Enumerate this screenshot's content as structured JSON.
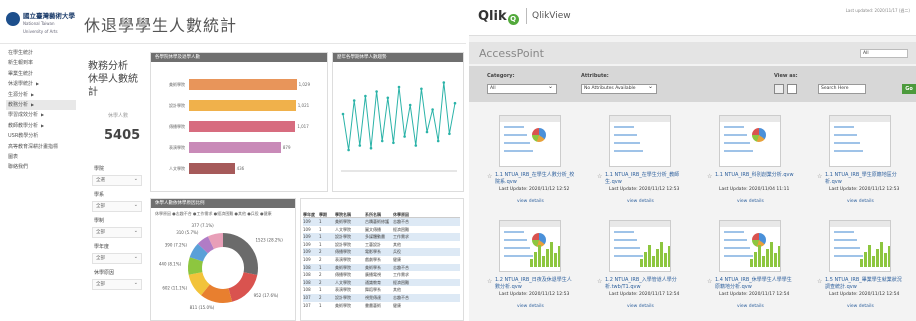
{
  "left": {
    "logo_text": "國立臺灣藝術大學",
    "logo_sub": "National Taiwan University of Arts",
    "page_title": "休退學學生人數統計",
    "nav": [
      {
        "label": "在學生統計",
        "arrow": false
      },
      {
        "label": "新生報到率",
        "arrow": false
      },
      {
        "label": "畢業生統計",
        "arrow": false
      },
      {
        "label": "休退學統計",
        "arrow": true
      },
      {
        "label": "生源分析",
        "arrow": true
      },
      {
        "label": "教務分析",
        "arrow": true,
        "active": true
      },
      {
        "label": "學習成效分析",
        "arrow": true
      },
      {
        "label": "教師教學分析",
        "arrow": true
      },
      {
        "label": "USR教學分析",
        "arrow": false
      },
      {
        "label": "高等教育深耕計畫指標",
        "arrow": false
      },
      {
        "label": "圖表",
        "arrow": false
      },
      {
        "label": "聯絡我們",
        "arrow": false
      }
    ],
    "section_title_1": "教務分析",
    "section_title_2": "休學人數統計",
    "kpi_label": "休學人數",
    "kpi_value": "5405",
    "filters": [
      {
        "label": "學院",
        "value": "全選"
      },
      {
        "label": "學系",
        "value": "全部"
      },
      {
        "label": "學制",
        "value": "全部"
      },
      {
        "label": "學年度",
        "value": "全部"
      },
      {
        "label": "休學原因",
        "value": "全部"
      }
    ],
    "bar_panel_title": "各學院休學及退學人數",
    "bars": [
      {
        "label": "美術學院",
        "value": "1,029",
        "color": "#e8955a"
      },
      {
        "label": "設計學院",
        "value": "1,021",
        "color": "#f0b14b"
      },
      {
        "label": "傳播學院",
        "value": "1,017",
        "color": "#d76c7f"
      },
      {
        "label": "表演學院",
        "value": "879",
        "color": "#c98ab8"
      },
      {
        "label": "人文學院",
        "value": "436",
        "color": "#a65a5a"
      }
    ],
    "line_panel_title": "歷年各學期休學人數趨勢",
    "line_values": [
      60,
      20,
      75,
      25,
      80,
      22,
      85,
      30,
      78,
      28,
      90,
      35,
      70,
      25,
      88,
      40,
      65,
      30,
      95,
      38,
      72
    ],
    "donut_panel_title": "休學人數依休學原因比例",
    "donut_legend": "休學原因 ●志趣不合 ●工作需求 ●經濟困難 ●其他 ●兵役 ●健康",
    "donut_slices": [
      {
        "label": "1523 (28.2%)",
        "pct": 28.2,
        "color": "#6b6b6b"
      },
      {
        "label": "952 (17.6%)",
        "pct": 17.6,
        "color": "#d9534f"
      },
      {
        "label": "811 (15.0%)",
        "pct": 15.0,
        "color": "#e87f2f"
      },
      {
        "label": "602 (11.1%)",
        "pct": 11.1,
        "color": "#f2c33a"
      },
      {
        "label": "440 (8.1%)",
        "pct": 8.1,
        "color": "#8dc63f"
      },
      {
        "label": "390 (7.2%)",
        "pct": 7.2,
        "color": "#5aa0d8"
      },
      {
        "label": "310 (5.7%)",
        "pct": 5.7,
        "color": "#b07cc6"
      },
      {
        "label": "377 (7.1%)",
        "pct": 7.1,
        "color": "#e89fb8"
      }
    ],
    "table_headers": [
      "學年度",
      "學期",
      "學院名稱",
      "系所名稱",
      "休學原因"
    ],
    "table_rows": [
      [
        "109",
        "1",
        "美術學院",
        "古蹟藝術修護",
        "志趣不合"
      ],
      [
        "109",
        "1",
        "人文學院",
        "圖文傳播",
        "經濟困難"
      ],
      [
        "109",
        "1",
        "設計學院",
        "多媒體動畫",
        "工作需求"
      ],
      [
        "109",
        "1",
        "設計學院",
        "工藝設計",
        "其他"
      ],
      [
        "109",
        "2",
        "傳播學院",
        "電影學系",
        "兵役"
      ],
      [
        "109",
        "2",
        "表演學院",
        "戲劇學系",
        "健康"
      ],
      [
        "108",
        "1",
        "美術學院",
        "美術學系",
        "志趣不合"
      ],
      [
        "108",
        "2",
        "傳播學院",
        "廣播電視",
        "工作需求"
      ],
      [
        "108",
        "2",
        "人文學院",
        "通識教育",
        "經濟困難"
      ],
      [
        "108",
        "1",
        "表演學院",
        "舞蹈學系",
        "其他"
      ],
      [
        "107",
        "2",
        "設計學院",
        "視覺傳達",
        "志趣不合"
      ],
      [
        "107",
        "1",
        "美術學院",
        "書畫藝術",
        "健康"
      ]
    ]
  },
  "right": {
    "brand": "Qlik",
    "brand_icon": "Q",
    "product": "QlikView",
    "last_updated": "Last updated: 2020/11/17 (週二)",
    "ap_title": "AccessPoint",
    "ap_select": "All",
    "category_label": "Category:",
    "category_value": "All",
    "attribute_label": "Attribute:",
    "attribute_value": "No Attributes Available",
    "viewas_label": "View as:",
    "search_placeholder": "Search Here",
    "go_label": "Go",
    "tiles": [
      {
        "name": "1.1 NTUA_IRB_在學生人數分析_校院系.qvw",
        "date": "Last Update: 2020/11/12 12:52",
        "details": "view details"
      },
      {
        "name": "1.1 NTUA_IRB_在學生分析_教師生.qvw",
        "date": "Last Update: 2020/11/12 12:53",
        "details": "view details"
      },
      {
        "name": "1.1 NTUA_IRB_科別創業分析.qvw",
        "date": "Last Update: 2020/11/04 11:11",
        "details": "view details"
      },
      {
        "name": "1.1 NTUA_IRB_學生原籍地區分析.qvw",
        "date": "Last Update: 2020/11/12 12:53",
        "details": "view details"
      },
      {
        "name": "1.2 NTUA_IRB_日夜及休退學生人數分析.qvw",
        "date": "Last Update: 2020/11/12 12:53",
        "details": "view details"
      },
      {
        "name": "1.2 NTUA_IRB_入學管道人學分析.twb/T1.qvw",
        "date": "Last Update: 2020/11/17 12:54",
        "details": "view details"
      },
      {
        "name": "1.4 NTUA_IRB_休學學生人學學生原籍地分析.qvw",
        "date": "Last Update: 2020/11/17 12:54",
        "details": "view details"
      },
      {
        "name": "1.5 NTUA_IRB_畢業學生就業狀況調查統計.qvw",
        "date": "Last Update: 2020/11/12 12:54",
        "details": "view details"
      }
    ]
  }
}
